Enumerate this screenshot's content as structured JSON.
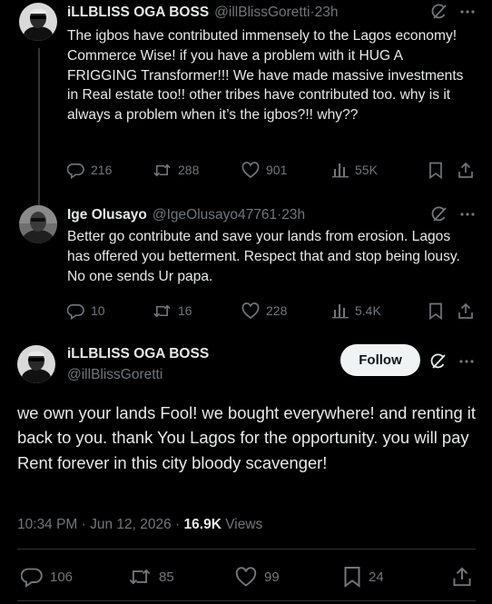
{
  "tweets": [
    {
      "name": "iLLBLISS OGA BOSS",
      "handle": "@illBlissGoretti",
      "time": "23h",
      "text": "The igbos have contributed immensely to the Lagos economy! Commerce Wise! if you have a problem with it HUG A FRIGGING Transformer!!! We have made massive investments in Real estate too!! other tribes have contributed too. why is it always a problem when it’s the igbos?!! why??",
      "replies": "216",
      "reposts": "288",
      "likes": "901",
      "views": "55K"
    },
    {
      "name": "Ige Olusayo",
      "handle": "@IgeOlusayo47761",
      "time": "23h",
      "text": "Better go contribute and save your lands from erosion. Lagos has offered you betterment. Respect that and stop being lousy. No one sends Ur papa.",
      "replies": "10",
      "reposts": "16",
      "likes": "228",
      "views": "5.4K"
    }
  ],
  "main": {
    "name": "iLLBLISS OGA BOSS",
    "handle": "@illBlissGoretti",
    "follow_label": "Follow",
    "text": "we own your lands Fool! we bought everywhere! and renting it back to you. thank You Lagos for the opportunity. you will pay Rent forever in this city bloody scavenger!",
    "timestamp": "10:34 PM · Jun 12, 2026 · ",
    "views_count": "16.9K",
    "views_label": " Views",
    "replies": "106",
    "reposts": "85",
    "likes": "99",
    "bookmarks": "24"
  },
  "separators": {
    "dot": " · "
  },
  "icons": {
    "more": "more-icon",
    "grok": "grok-icon",
    "reply": "reply-icon",
    "repost": "repost-icon",
    "like": "like-icon",
    "views": "views-icon",
    "bookmark": "bookmark-icon",
    "share": "share-icon"
  },
  "colors": {
    "background": "#000000",
    "text": "#e7e9ea",
    "secondary": "#71767b",
    "follow_bg": "#eff3f4"
  }
}
